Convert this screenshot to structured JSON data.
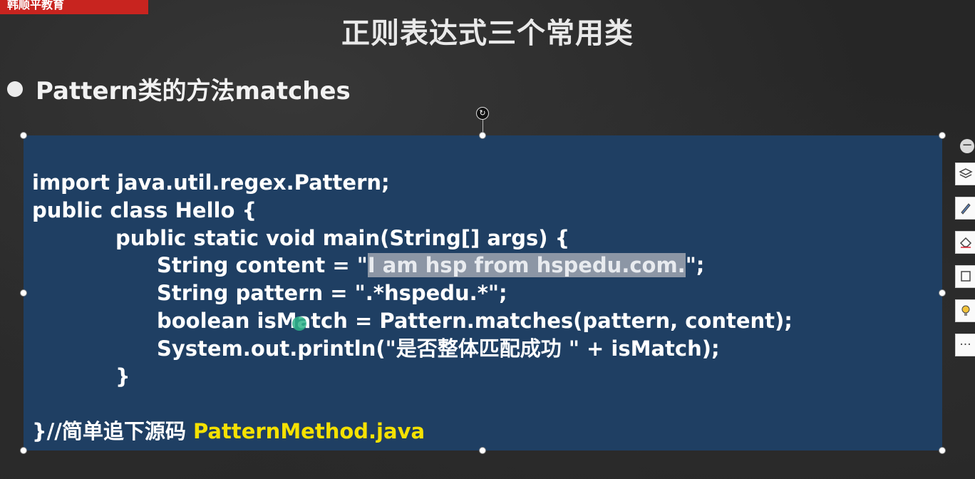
{
  "logo": {
    "text": "韩顺平教育"
  },
  "slide": {
    "title": "正则表达式三个常用类",
    "bullet": "Pattern类的方法matches"
  },
  "code": {
    "line1": "import java.util.regex.Pattern;",
    "line2": "public class Hello {",
    "line3": "public static void main(String[] args) {",
    "line4_prefix": "String content = \"",
    "line4_highlight": "I am hsp from hspedu.com.",
    "line4_suffix": "\";",
    "line5": "String pattern = \".*hspedu.*\";",
    "line6": "boolean isMatch = Pattern.matches(pattern, content);",
    "line7": "System.out.println(\"是否整体匹配成功 \" + isMatch);",
    "line8": "}",
    "line9": "",
    "line10_prefix": "}//简单追下源码 ",
    "line10_highlight": "PatternMethod.java"
  },
  "colors": {
    "code_background": "#1f3f63",
    "highlight_text": "#f5e100",
    "selection": "#8c96a5",
    "logo_red": "#c8241f"
  },
  "toolbar": {
    "icons": [
      "minus-icon",
      "layers-icon",
      "pen-icon",
      "eraser-icon",
      "crop-icon",
      "lightbulb-icon",
      "more-icon"
    ],
    "more_label": "···"
  }
}
